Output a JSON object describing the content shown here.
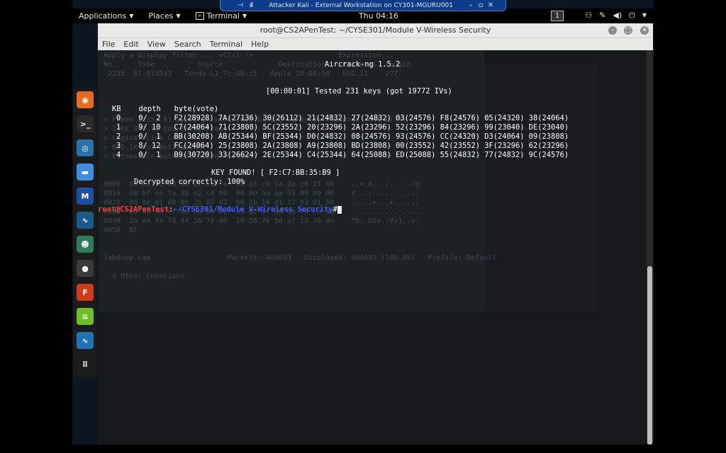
{
  "vm_bar": {
    "title": "Attacker Kali - External Workstation on CY301-MGURU001",
    "pin_icon": "pin-icon",
    "signal_icon": "signal-icon",
    "controls": [
      "–",
      "▫",
      "✕"
    ]
  },
  "topbar": {
    "applications": "Applications",
    "places": "Places",
    "terminal": "Terminal",
    "clock": "Thu 04:16",
    "workspace": "1",
    "tray_icons": [
      "people-icon",
      "pen-icon",
      "volume-icon",
      "power-icon",
      "chevron-down-icon"
    ]
  },
  "dock": {
    "items": [
      {
        "name": "firefox-icon",
        "color": "#e76a22",
        "glyph": "◉"
      },
      {
        "name": "terminal-icon",
        "color": "#2a2a2a",
        "glyph": ">_"
      },
      {
        "name": "eye-icon",
        "color": "#2b6fa8",
        "glyph": "◎"
      },
      {
        "name": "folder-icon",
        "color": "#3d8ee0",
        "glyph": "▬"
      },
      {
        "name": "metasploit-icon",
        "color": "#1e4fa2",
        "glyph": "M"
      },
      {
        "name": "wireshark-icon",
        "color": "#1a5a8a",
        "glyph": "∿"
      },
      {
        "name": "person-icon",
        "color": "#2f7b5a",
        "glyph": "☻"
      },
      {
        "name": "maltego-icon",
        "color": "#3b3b3b",
        "glyph": "●"
      },
      {
        "name": "faraday-icon",
        "color": "#d03a1c",
        "glyph": "F"
      },
      {
        "name": "notes-icon",
        "color": "#6dbf2a",
        "glyph": "≡"
      },
      {
        "name": "wireshark2-icon",
        "color": "#1f73b4",
        "glyph": "∿"
      },
      {
        "name": "app-grid-icon",
        "color": "#1c1c1c",
        "glyph": "⠿"
      }
    ]
  },
  "window": {
    "title": "root@CS2APenTest: ~/CYSE301/Module V-Wireless Security",
    "menu": [
      "File",
      "Edit",
      "View",
      "Search",
      "Terminal",
      "Help"
    ]
  },
  "terminal": {
    "header": "Aircrack-ng 1.5.2",
    "status": "[00:00:01] Tested 231 keys (got 19772 IVs)",
    "table_header": "KB    depth   byte(vote)",
    "rows": [
      "0    0/  2   F2(28928) 7A(27136) 30(26112) 21(24832) 27(24832) 03(24576) F8(24576) 05(24320) 38(24064)",
      "1    9/ 10   C7(24064) 71(23808) 5C(23552) 20(23296) 2A(23296) 52(23296) 84(23296) 99(23040) DE(23040)",
      "2    0/  1   BB(30208) AB(25344) BF(25344) D0(24832) 08(24576) 93(24576) CC(24320) D3(24064) 09(23808)",
      "3    8/ 12   FC(24064) 25(23808) 2A(23808) A9(23808) BD(23808) 00(23552) 42(23552) 3F(23296) 62(23296)",
      "4    0/  1   B9(30720) 33(26624) 2E(25344) C4(25344) 64(25088) ED(25088) 55(24832) 77(24832) 9C(24576)"
    ],
    "key_found": "KEY FOUND! [ F2:C7:BB:35:B9 ]",
    "decrypted": "Decrypted correctly: 100%",
    "prompt_user": "root@CS2APenTest",
    "prompt_sep": ":",
    "prompt_path": "~/CYSE301/Module V-Wireless Security",
    "prompt_end": "#"
  },
  "ghost": {
    "lines": [
      "Apply a display filter ... <Ctrl-/>                    Expression...",
      "No.     Time          Source             Destination    Protocol  Length",
      " 2235  67.815543   Tenda-L1_7c:d0:c5   Apple_20:08:50   802.11    277",
      "",
      "",
      "",
      "",
      "> Frame 2235: 81 bytes on wire (648 bits), 81 bytes captured (648 bits)",
      "> IEEE 802.11 QoS Data, Flags: ......F.",
      "> Logical-Link Control",
      "> 802.1X Authentication",
      "> Extensible Authentication Protocol",
      "",
      "",
      "0000  88 01 3c 00 58 bf ea fa  3b a2 c0 1a da c0 21 40    ..<.X...;.....!@",
      "0010  58 bf ea fa 3b a2 c0 00  00 00 aa aa 03 00 00 00    X...;...........",
      "0020  88 8e 01 00 00 2b 02 02  00 2b 10 01 17 03 01 00    .....+...+......",
      "0030  20 e3 de cf 89 9d 01 0c  d5 db 5f 00 8a f4 ca 9a     .........._.....",
      "0040  2a 44 fe f8 44 36 78 08  19 56 76 5d a7 13 76 de    *D..D6x..Vv]..v.",
      "0050  8f",
      "",
      "",
      "lab4wep.cap                  Packets: 404693 · Displayed: 404693 (100.0%)   Profile: Default",
      "",
      "  + Other Locations"
    ]
  }
}
